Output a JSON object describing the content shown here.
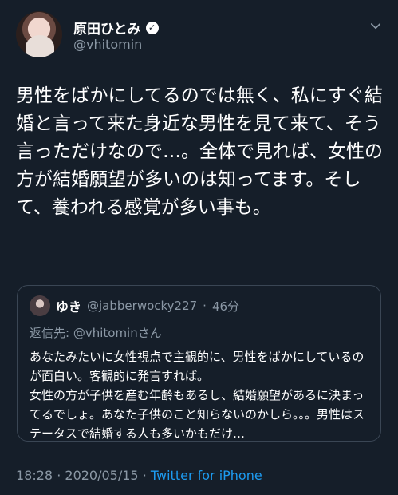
{
  "author": {
    "name": "原田ひとみ",
    "handle": "@vhitomin"
  },
  "tweet": {
    "text": "男性をばかにしてるのでは無く、私にすぐ結婚と言って来た身近な男性を見て来て、そう言っただけなので…。全体で見れば、女性の方が結婚願望が多いのは知ってます。そして、養われる感覚が多い事も。"
  },
  "quoted": {
    "name": "ゆき",
    "handle": "@jabberwocky227",
    "separator": "·",
    "time": "46分",
    "reply_prefix": "返信先: ",
    "reply_to": "@vhitominさん",
    "text": "あなたみたいに女性視点で主観的に、男性をばかにしているのが面白い。客観的に発言すれば。\n女性の方が子供を産む年齢もあるし、結婚願望があるに決まってるでしょ。あなた子供のこと知らないのかしら。。。男性はステータスで結婚する人も多いかもだけ…"
  },
  "footer": {
    "time": "18:28",
    "separator": "·",
    "date": "2020/05/15",
    "separator2": "·",
    "source": "Twitter for iPhone"
  },
  "icons": {
    "verified": "verified-badge-icon",
    "menu": "chevron-down-icon"
  }
}
